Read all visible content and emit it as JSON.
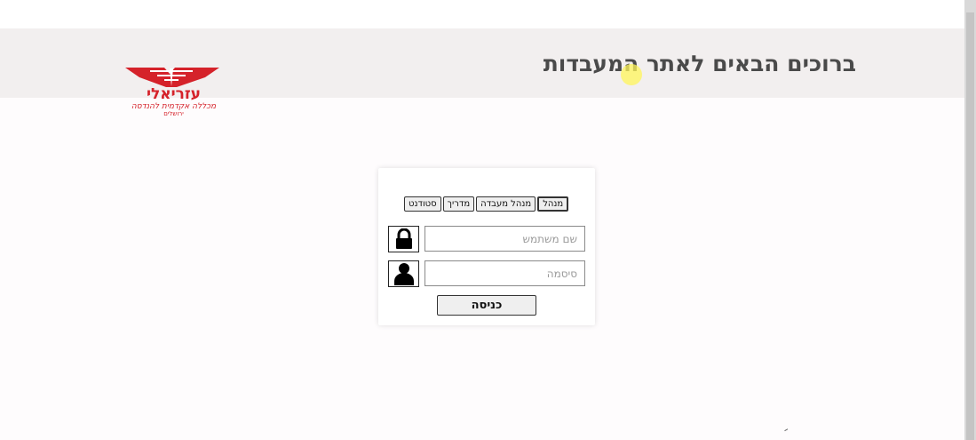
{
  "header": {
    "title": "ברוכים הבאים לאתר המעבדות"
  },
  "logo": {
    "name": "עזריאלי",
    "subtitle": "מכללה אקדמית להנדסה",
    "city": "ירושלים"
  },
  "login": {
    "roles": [
      {
        "label": "מנהל",
        "selected": true
      },
      {
        "label": "מנהל מעבדה",
        "selected": false
      },
      {
        "label": "מדריך",
        "selected": false
      },
      {
        "label": "סטודנט",
        "selected": false
      }
    ],
    "username_placeholder": "שם משתמש",
    "username_value": "",
    "password_placeholder": "סיסמה",
    "password_value": "",
    "submit_label": "כניסה",
    "lock_icon": "lock-icon",
    "user_icon": "user-icon"
  },
  "colors": {
    "brand_red": "#d5222a",
    "header_bg": "#f2efef",
    "title_text": "#4a4a4a"
  }
}
